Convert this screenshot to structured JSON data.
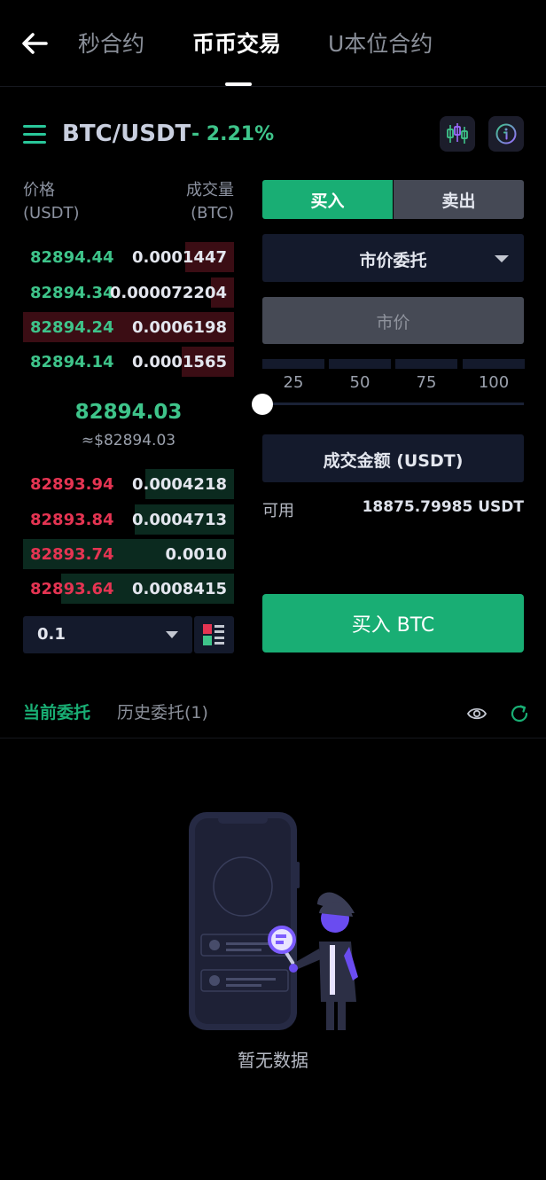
{
  "nav": {
    "tabs": [
      {
        "label": "秒合约"
      },
      {
        "label": "币币交易"
      },
      {
        "label": "U本位合约"
      }
    ],
    "active_tab": "币币交易"
  },
  "pair": {
    "symbol": "BTC/USDT",
    "change": "- 2.21%"
  },
  "orderbook": {
    "price_header": "价格",
    "price_unit": "(USDT)",
    "volume_header": "成交量",
    "volume_unit": "(BTC)",
    "asks": [
      {
        "price": "82894.44",
        "amount": "0.0001447",
        "depth": 0.23
      },
      {
        "price": "82894.34",
        "amount": "0.000072204",
        "depth": 0.11
      },
      {
        "price": "82894.24",
        "amount": "0.0006198",
        "depth": 1.0
      },
      {
        "price": "82894.14",
        "amount": "0.0001565",
        "depth": 0.25
      }
    ],
    "last_price": "82894.03",
    "last_price_fiat": "≈$82894.03",
    "bids": [
      {
        "price": "82893.94",
        "amount": "0.0004218",
        "depth": 0.42
      },
      {
        "price": "82893.84",
        "amount": "0.0004713",
        "depth": 0.47
      },
      {
        "price": "82893.74",
        "amount": "0.0010",
        "depth": 1.0
      },
      {
        "price": "82893.64",
        "amount": "0.0008415",
        "depth": 0.82
      }
    ],
    "precision": "0.1"
  },
  "trade": {
    "buy_label": "买入",
    "sell_label": "卖出",
    "order_type": "市价委托",
    "market_price_label": "市价",
    "percent_options": [
      "25",
      "50",
      "75",
      "100"
    ],
    "slider_value": 0,
    "amount_placeholder": "成交金额 (USDT)",
    "available_label": "可用",
    "available_value": "18875.79985 USDT",
    "submit_label": "买入 BTC"
  },
  "orders": {
    "current_tab": "当前委托",
    "history_tab": "历史委托(1)",
    "empty_text": "暂无数据"
  },
  "colors": {
    "buy_green": "#19ae74",
    "price_up": "#3ec48a",
    "price_down": "#e53452",
    "panel_bg": "#141a2c"
  }
}
